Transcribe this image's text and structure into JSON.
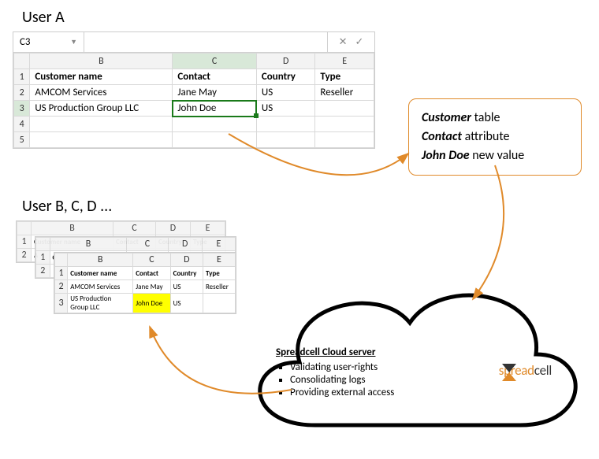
{
  "titles": {
    "userA": "User A",
    "userB": "User B, C, D ..."
  },
  "namebox": "C3",
  "columns": [
    "B",
    "C",
    "D",
    "E"
  ],
  "headers": {
    "customer": "Customer name",
    "contact": "Contact",
    "country": "Country",
    "type": "Type"
  },
  "rows": [
    {
      "n": "1"
    },
    {
      "n": "2",
      "customer": "AMCOM Services",
      "contact": "Jane May",
      "country": "US",
      "type": "Reseller"
    },
    {
      "n": "3",
      "customer": "US Production Group LLC",
      "contact": "John Doe",
      "country": "US",
      "type": ""
    },
    {
      "n": "4"
    },
    {
      "n": "5"
    }
  ],
  "chart_data": {
    "type": "table",
    "columns": [
      "Customer name",
      "Contact",
      "Country",
      "Type"
    ],
    "rows": [
      [
        "AMCOM Services",
        "Jane May",
        "US",
        "Reseller"
      ],
      [
        "US Production Group LLC",
        "John Doe",
        "US",
        ""
      ]
    ]
  },
  "callout": {
    "l1a": "Customer",
    "l1b": " table",
    "l2a": "Contact",
    "l2b": " attribute",
    "l3a": "John Doe",
    "l3b": " new value"
  },
  "cloud": {
    "title": "Spreadcell Cloud server",
    "items": [
      "Validating user-rights",
      "Consolidating logs",
      "Providing external access"
    ],
    "brand1": "spread",
    "brand2": "cell"
  }
}
